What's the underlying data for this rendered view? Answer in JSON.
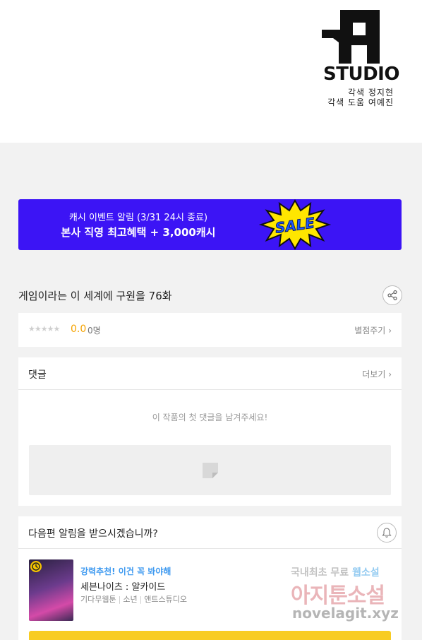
{
  "credits": {
    "logo_text": "STUDIO",
    "line1": "각색 정지현",
    "line2": "각색 도움 여예진"
  },
  "banner": {
    "line1": "캐시 이벤트 알림 (3/31 24시 종료)",
    "line2": "본사 직영 최고혜택 + 3,000캐시",
    "badge_text": "SALE",
    "color": "#3c14f5"
  },
  "episode": {
    "title": "게임이라는 이 세계에 구원을 76화",
    "share_icon": "share-icon"
  },
  "rating": {
    "stars": "★★★★★",
    "value": "0.0",
    "count": "0명",
    "rate_link": "별점주기"
  },
  "comments": {
    "title": "댓글",
    "more_link": "더보기",
    "empty_message": "이 작품의 첫 댓글을 남겨주세요!"
  },
  "notify": {
    "question": "다음편 알림을 받으시겠습니까?",
    "bell_icon": "bell-icon"
  },
  "recommendation": {
    "tag": "강력추천! 이건 꼭 봐야해",
    "title": "세븐나이츠 : 알카이드",
    "meta": [
      "기다무웹툰",
      "소년",
      "앤트스튜디오"
    ]
  },
  "watermark": {
    "line1_prefix": "국내최초 무료 ",
    "line1_highlight": "웹소설",
    "line2": "아지툰소설",
    "line3": "novelagit.xyz"
  }
}
